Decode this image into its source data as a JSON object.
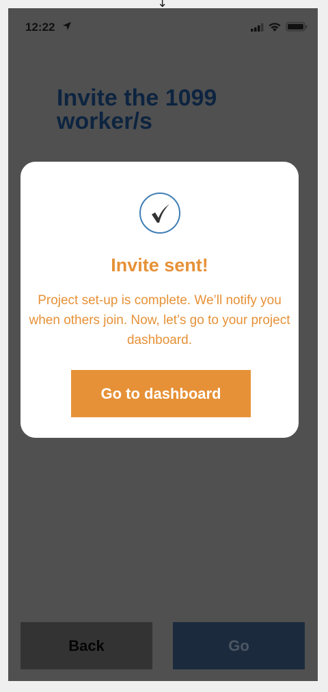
{
  "status_bar": {
    "time": "12:22",
    "icons": [
      "location-arrow-icon",
      "signal-bars-icon",
      "wifi-icon",
      "battery-icon"
    ]
  },
  "page": {
    "title": "Invite the 1099 worker/s"
  },
  "modal": {
    "icon": "checkmark-circle-icon",
    "title": "Invite sent!",
    "message": "Project set-up is complete. We’ll notify you when others join. Now, let’s go to your project dashboard.",
    "button_label": "Go to dashboard"
  },
  "footer": {
    "back_label": "Back",
    "go_label": "Go"
  },
  "colors": {
    "accent": "#e69137",
    "title": "#0d2440",
    "overlay": "#505050",
    "check_circle": "#3d7db5"
  }
}
